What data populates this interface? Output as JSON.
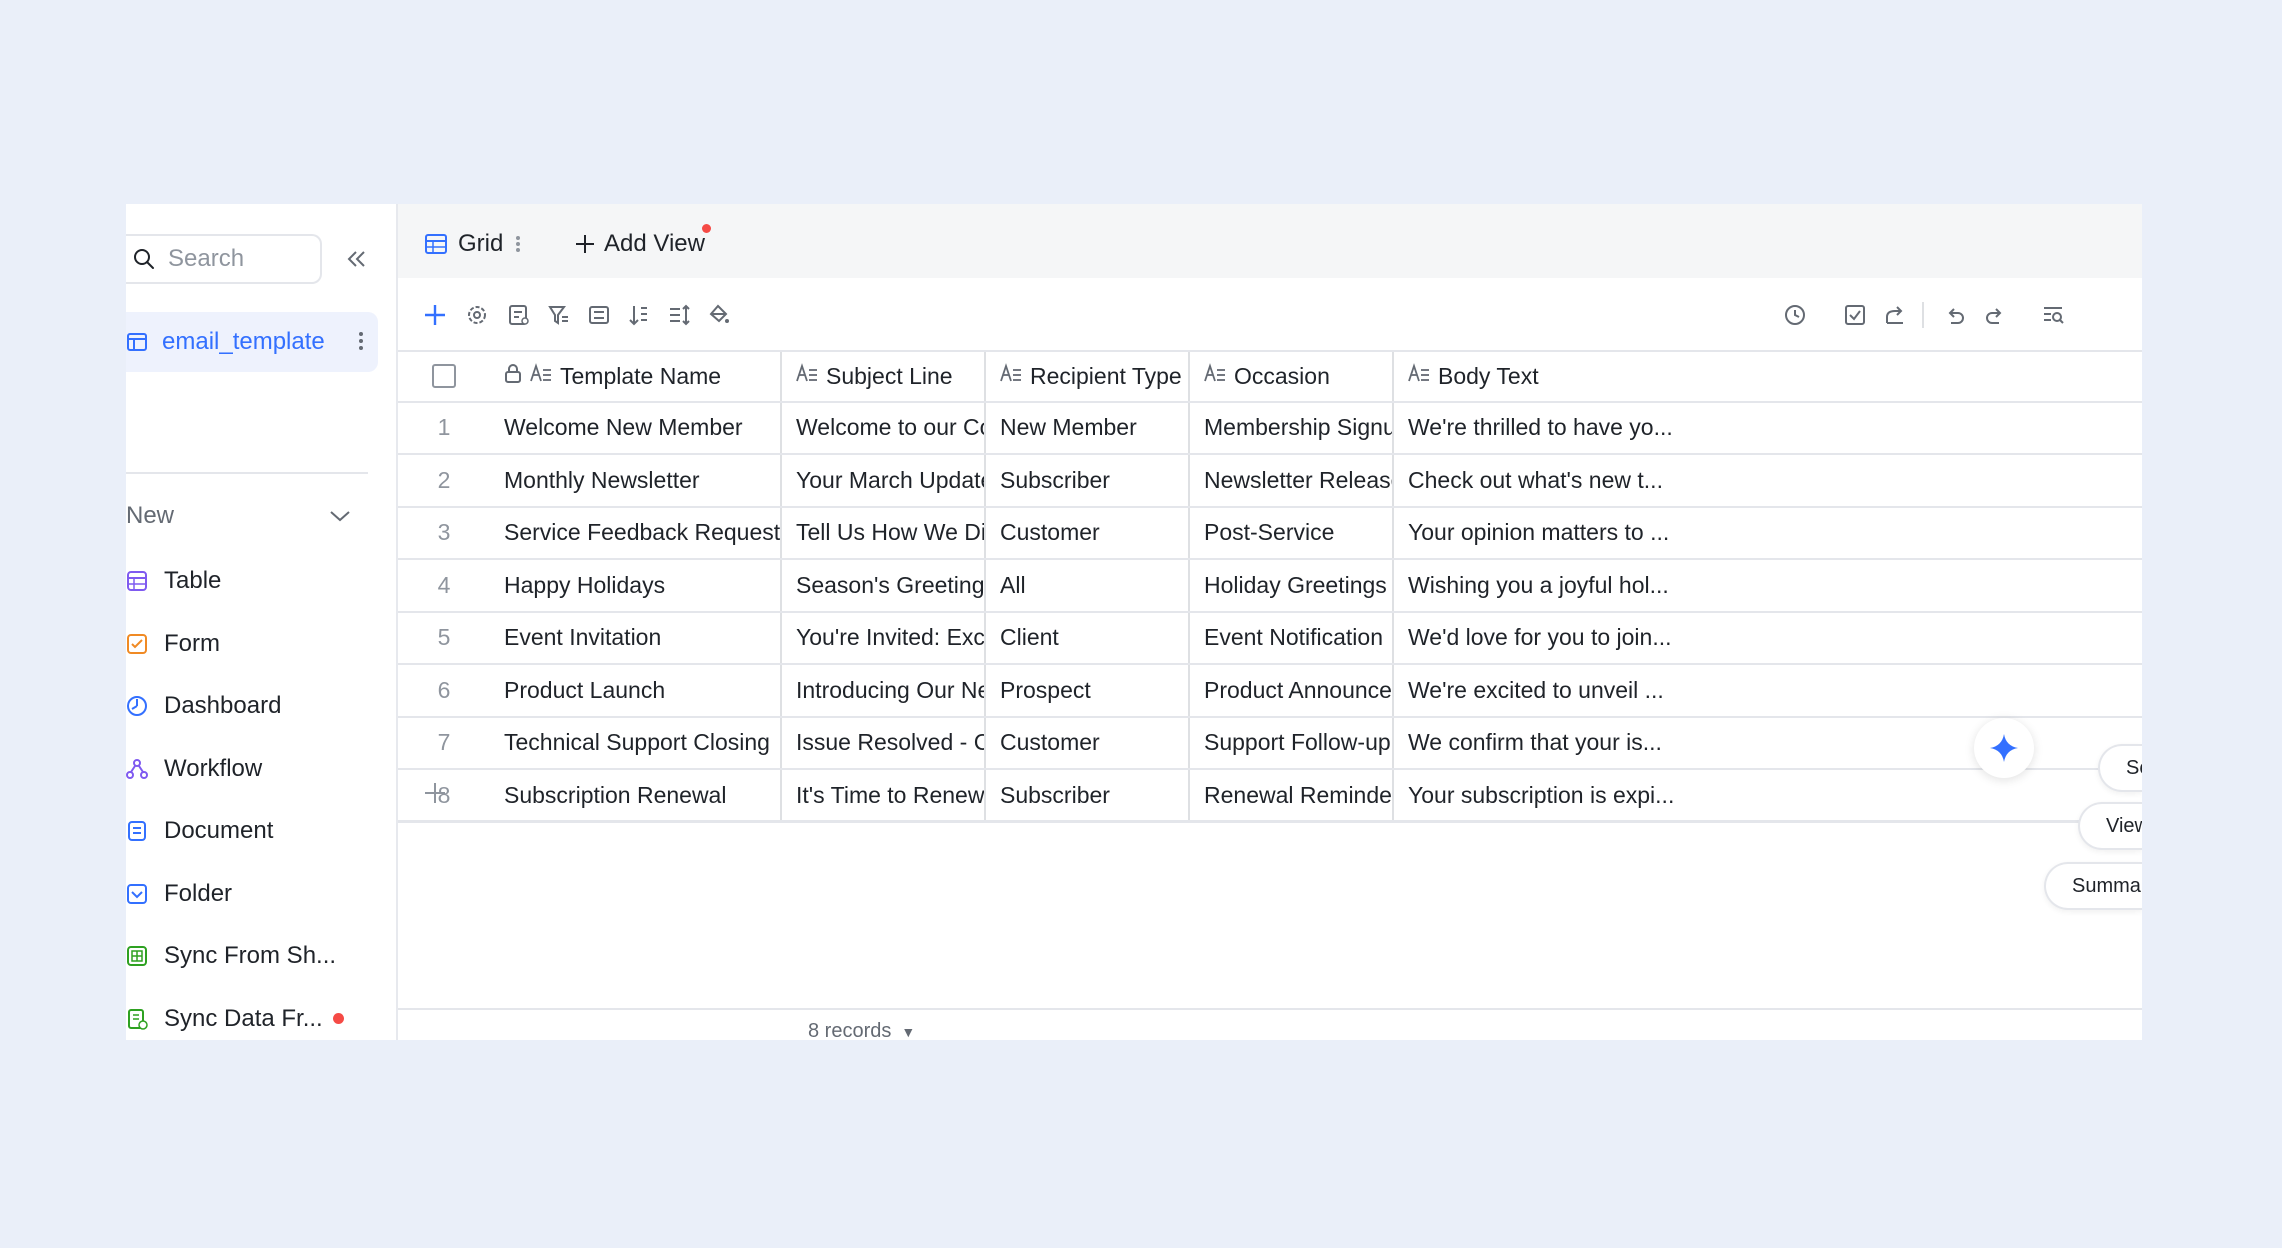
{
  "sidebar": {
    "search_placeholder": "Search",
    "active_table": "email_template",
    "new_section_label": "New",
    "new_items": [
      {
        "label": "Table",
        "icon": "table-icon"
      },
      {
        "label": "Form",
        "icon": "form-icon"
      },
      {
        "label": "Dashboard",
        "icon": "dashboard-icon"
      },
      {
        "label": "Workflow",
        "icon": "workflow-icon"
      },
      {
        "label": "Document",
        "icon": "document-icon"
      },
      {
        "label": "Folder",
        "icon": "folder-icon"
      },
      {
        "label": "Sync From Sh...",
        "icon": "sync-sheet-icon"
      },
      {
        "label": "Sync Data Fr...",
        "icon": "sync-data-icon"
      }
    ]
  },
  "viewbar": {
    "tab_label": "Grid",
    "add_view_label": "Add View"
  },
  "table": {
    "columns": [
      "Template Name",
      "Subject Line",
      "Recipient Type",
      "Occasion",
      "Body Text"
    ],
    "rows": [
      {
        "num": "1",
        "cells": [
          "Welcome New Member",
          "Welcome to our Commu...",
          "New Member",
          "Membership Signup",
          "We're thrilled to have yo..."
        ]
      },
      {
        "num": "2",
        "cells": [
          "Monthly Newsletter",
          "Your March Updates Insi...",
          "Subscriber",
          "Newsletter Release",
          "Check out what's new t..."
        ]
      },
      {
        "num": "3",
        "cells": [
          "Service Feedback Request",
          "Tell Us How We Did",
          "Customer",
          "Post-Service",
          "Your opinion matters to ..."
        ]
      },
      {
        "num": "4",
        "cells": [
          "Happy Holidays",
          "Season's Greetings from...",
          "All",
          "Holiday Greetings",
          "Wishing you a joyful hol..."
        ]
      },
      {
        "num": "5",
        "cells": [
          "Event Invitation",
          "You're Invited: Exclusive...",
          "Client",
          "Event Notification",
          "We'd love for you to join..."
        ]
      },
      {
        "num": "6",
        "cells": [
          "Product Launch",
          "Introducing Our New Pr...",
          "Prospect",
          "Product Announcement",
          "We're excited to unveil ..."
        ]
      },
      {
        "num": "7",
        "cells": [
          "Technical Support Closing",
          "Issue Resolved - Case #...",
          "Customer",
          "Support Follow-up",
          "We confirm that your is..."
        ]
      },
      {
        "num": "8",
        "cells": [
          "Subscription Renewal",
          "It's Time to Renew Your...",
          "Subscriber",
          "Renewal Reminder",
          "Your subscription is expi..."
        ]
      }
    ]
  },
  "footer": {
    "record_count": "8 records"
  },
  "floating": {
    "search_records": "Search Records",
    "view_user_guides": "View User Guides",
    "summarize": "Summarize This Base"
  },
  "colors": {
    "accent": "#3370ff",
    "background": "#eaeff9",
    "badge": "#f54a45"
  }
}
